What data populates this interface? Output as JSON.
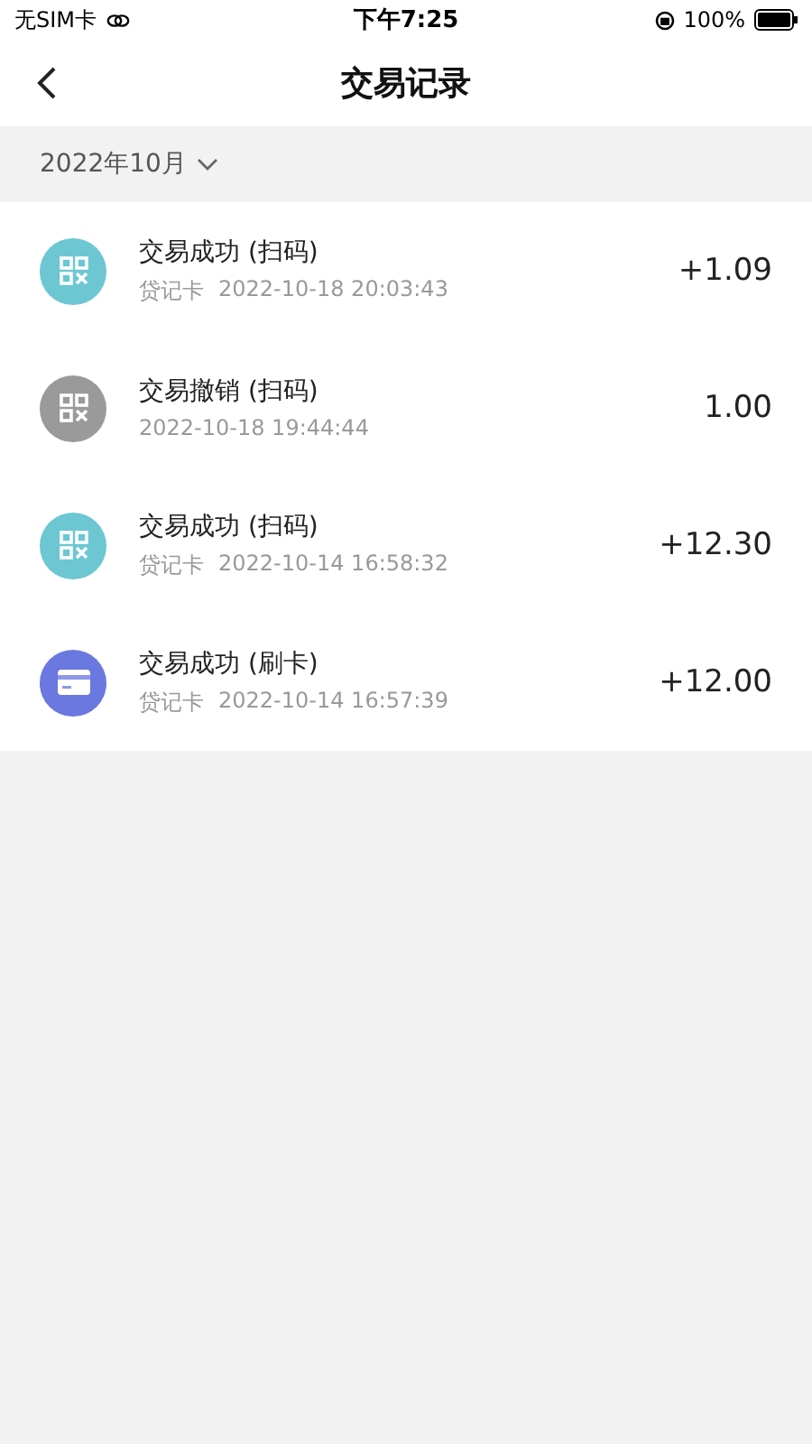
{
  "status_bar": {
    "carrier": "无SIM卡",
    "time": "下午7:25",
    "battery": "100%"
  },
  "nav": {
    "title": "交易记录"
  },
  "month_filter": {
    "label": "2022年10月"
  },
  "transactions": [
    {
      "title": "交易成功 (扫码)",
      "card_type": "贷记卡",
      "datetime": "2022-10-18 20:03:43",
      "amount": "+1.09",
      "kind": "qr",
      "color": "#6cc7d2"
    },
    {
      "title": "交易撤销 (扫码)",
      "datetime": "2022-10-18 19:44:44",
      "amount": "1.00",
      "kind": "qr",
      "color": "#9a9a9a"
    },
    {
      "title": "交易成功 (扫码)",
      "card_type": "贷记卡",
      "datetime": "2022-10-14 16:58:32",
      "amount": "+12.30",
      "kind": "qr",
      "color": "#6cc7d2"
    },
    {
      "title": "交易成功 (刷卡)",
      "card_type": "贷记卡",
      "datetime": "2022-10-14 16:57:39",
      "amount": "+12.00",
      "kind": "card",
      "color": "#6a78e0"
    }
  ]
}
